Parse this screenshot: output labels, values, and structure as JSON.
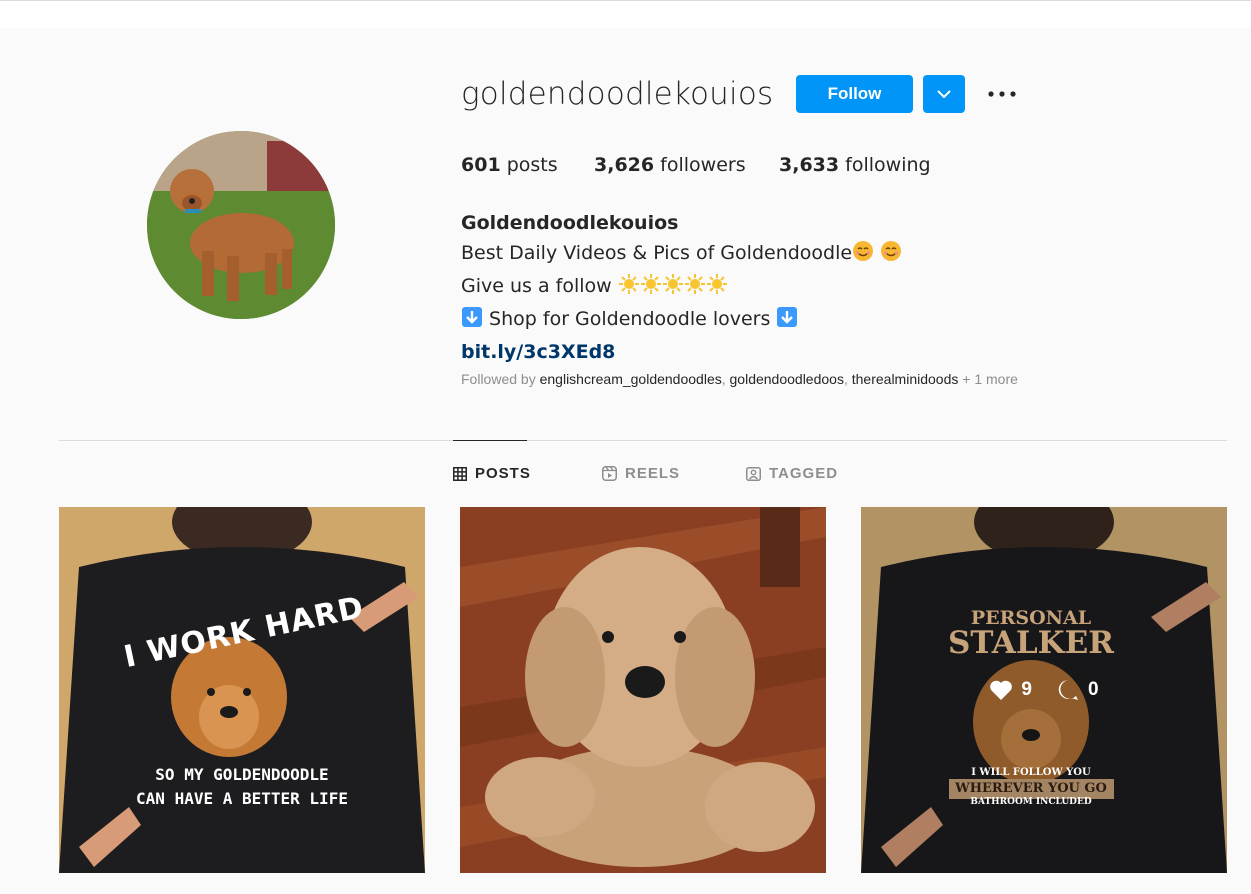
{
  "profile": {
    "username": "goldendoodlekouios",
    "follow_label": "Follow",
    "posts_count": "601",
    "posts_label": "posts",
    "followers_count": "3,626",
    "followers_label": "followers",
    "following_count": "3,633",
    "following_label": "following",
    "display_name": "Goldendoodlekouios",
    "bio_line1": "Best Daily Videos & Pics of Goldendoodle",
    "bio_line2": "Give us a follow",
    "bio_line3": "Shop for Goldendoodle lovers",
    "link": "bit.ly/3c3XEd8",
    "followed_by_label": "Followed by",
    "followed_by": [
      "englishcream_goldendoodles",
      "goldendoodledoos",
      "therealminidoods"
    ],
    "followed_more": "+ 1 more"
  },
  "tabs": [
    {
      "label": "POSTS",
      "icon": "grid-icon",
      "active": true
    },
    {
      "label": "REELS",
      "icon": "reels-icon",
      "active": false
    },
    {
      "label": "TAGGED",
      "icon": "tagged-icon",
      "active": false
    }
  ],
  "posts": [
    {
      "shirt_line1": "I WORK HARD",
      "shirt_line2": "SO MY GOLDENDOODLE",
      "shirt_line3": "CAN HAVE A BETTER LIFE"
    },
    {
      "description_icon": "dog-photo"
    },
    {
      "shirt_line1": "PERSONAL",
      "shirt_line2": "STALKER",
      "shirt_line3": "I WILL FOLLOW YOU",
      "shirt_line4": "WHEREVER YOU GO",
      "shirt_line5": "BATHROOM INCLUDED",
      "likes": "9",
      "comments": "0"
    }
  ],
  "colors": {
    "accent": "#0095f6",
    "link": "#00376b",
    "muted": "#8e8e8e"
  }
}
